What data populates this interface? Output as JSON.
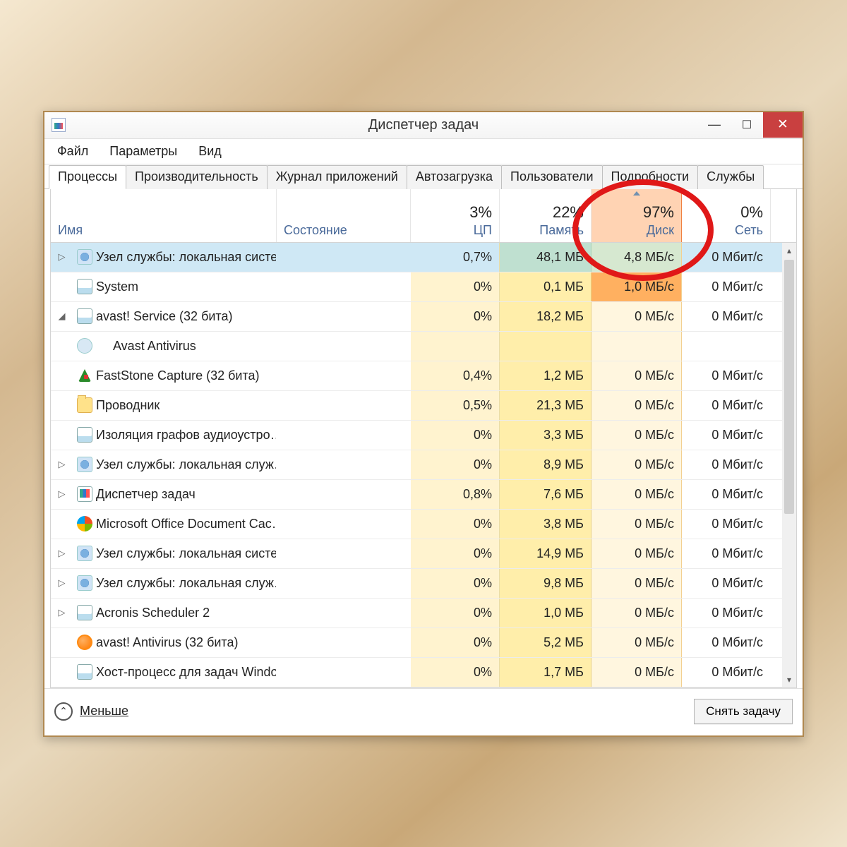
{
  "window": {
    "title": "Диспетчер задач"
  },
  "menu": {
    "file": "Файл",
    "options": "Параметры",
    "view": "Вид"
  },
  "tabs": {
    "processes": "Процессы",
    "performance": "Производительность",
    "app_history": "Журнал приложений",
    "startup": "Автозагрузка",
    "users": "Пользователи",
    "details": "Подробности",
    "services": "Службы"
  },
  "columns": {
    "name": "Имя",
    "state": "Состояние",
    "cpu": {
      "label": "ЦП",
      "pct": "3%"
    },
    "memory": {
      "label": "Память",
      "pct": "22%"
    },
    "disk": {
      "label": "Диск",
      "pct": "97%"
    },
    "network": {
      "label": "Сеть",
      "pct": "0%"
    }
  },
  "rows": [
    {
      "expander": "▷",
      "icon": "gear",
      "name": "Узел службы: локальная систе…",
      "cpu": "0,7%",
      "mem": "48,1 МБ",
      "disk": "4,8 МБ/с",
      "net": "0 Мбит/с",
      "selected": true
    },
    {
      "expander": "",
      "icon": "app",
      "name": "System",
      "cpu": "0%",
      "mem": "0,1 МБ",
      "disk": "1,0 МБ/с",
      "net": "0 Мбит/с",
      "disk_hot": true
    },
    {
      "expander": "◢",
      "icon": "app",
      "name": "avast! Service (32 бита)",
      "cpu": "0%",
      "mem": "18,2 МБ",
      "disk": "0 МБ/с",
      "net": "0 Мбит/с"
    },
    {
      "expander": "",
      "icon": "gear2",
      "name": "Avast Antivirus",
      "cpu": "",
      "mem": "",
      "disk": "",
      "net": "",
      "child": true
    },
    {
      "expander": "",
      "icon": "tri",
      "name": "FastStone Capture (32 бита)",
      "cpu": "0,4%",
      "mem": "1,2 МБ",
      "disk": "0 МБ/с",
      "net": "0 Мбит/с"
    },
    {
      "expander": "",
      "icon": "folder",
      "name": "Проводник",
      "cpu": "0,5%",
      "mem": "21,3 МБ",
      "disk": "0 МБ/с",
      "net": "0 Мбит/с"
    },
    {
      "expander": "",
      "icon": "app",
      "name": "Изоляция графов аудиоустро…",
      "cpu": "0%",
      "mem": "3,3 МБ",
      "disk": "0 МБ/с",
      "net": "0 Мбит/с"
    },
    {
      "expander": "▷",
      "icon": "gear",
      "name": "Узел службы: локальная служ…",
      "cpu": "0%",
      "mem": "8,9 МБ",
      "disk": "0 МБ/с",
      "net": "0 Мбит/с"
    },
    {
      "expander": "▷",
      "icon": "tm",
      "name": "Диспетчер задач",
      "cpu": "0,8%",
      "mem": "7,6 МБ",
      "disk": "0 МБ/с",
      "net": "0 Мбит/с"
    },
    {
      "expander": "",
      "icon": "ms",
      "name": "Microsoft Office Document Cac…",
      "cpu": "0%",
      "mem": "3,8 МБ",
      "disk": "0 МБ/с",
      "net": "0 Мбит/с"
    },
    {
      "expander": "▷",
      "icon": "gear",
      "name": "Узел службы: локальная систе…",
      "cpu": "0%",
      "mem": "14,9 МБ",
      "disk": "0 МБ/с",
      "net": "0 Мбит/с"
    },
    {
      "expander": "▷",
      "icon": "gear",
      "name": "Узел службы: локальная служ…",
      "cpu": "0%",
      "mem": "9,8 МБ",
      "disk": "0 МБ/с",
      "net": "0 Мбит/с"
    },
    {
      "expander": "▷",
      "icon": "app",
      "name": "Acronis Scheduler 2",
      "cpu": "0%",
      "mem": "1,0 МБ",
      "disk": "0 МБ/с",
      "net": "0 Мбит/с"
    },
    {
      "expander": "",
      "icon": "orange",
      "name": "avast! Antivirus (32 бита)",
      "cpu": "0%",
      "mem": "5,2 МБ",
      "disk": "0 МБ/с",
      "net": "0 Мбит/с"
    },
    {
      "expander": "",
      "icon": "app",
      "name": "Хост-процесс для задач Windo…",
      "cpu": "0%",
      "mem": "1,7 МБ",
      "disk": "0 МБ/с",
      "net": "0 Мбит/с"
    }
  ],
  "footer": {
    "fewer": "Меньше",
    "end_task": "Снять задачу"
  }
}
